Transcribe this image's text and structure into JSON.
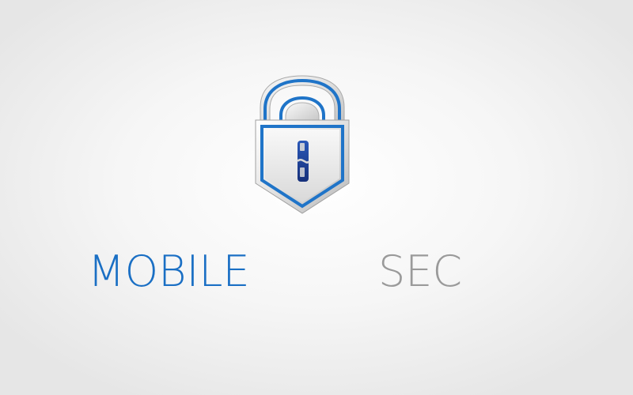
{
  "brand": {
    "name_first": "MOBILE",
    "name_second": "SEC",
    "colors": {
      "primary_blue": "#1a6fc4",
      "second_gray": "#9a9a9a",
      "keyhole_navy": "#1e3a8f"
    },
    "icon": "padlock-shield-icon"
  }
}
